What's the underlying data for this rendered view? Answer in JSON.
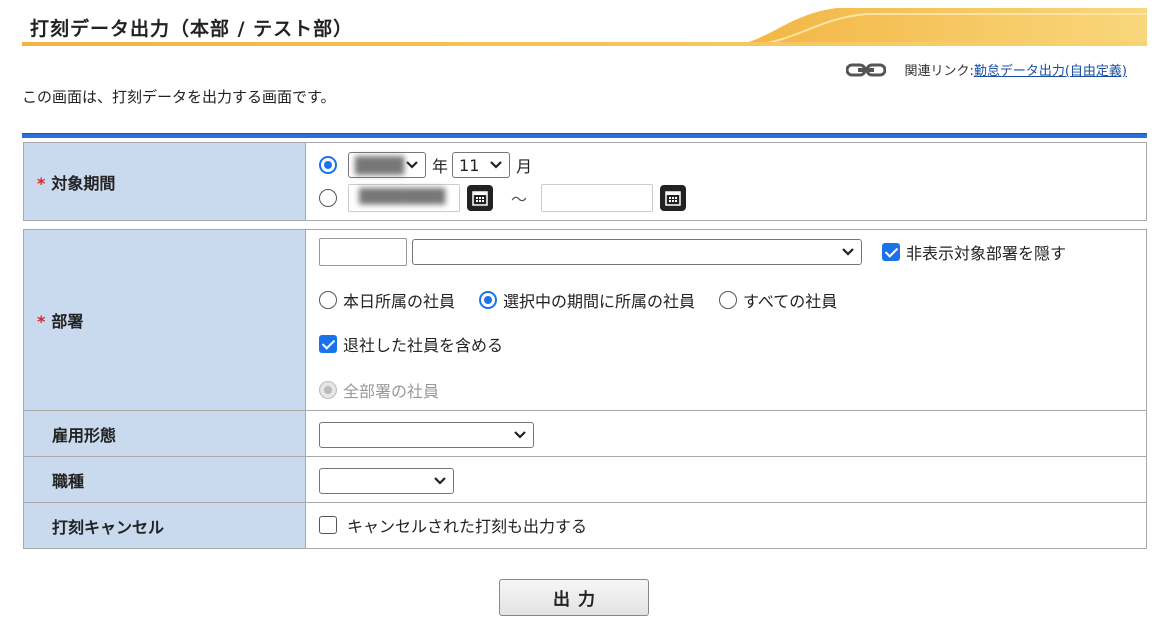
{
  "header": {
    "title": "打刻データ出力（本部 / テスト部）"
  },
  "related": {
    "prefix": "関連リンク: ",
    "link_label": "勤怠データ出力(自由定義)"
  },
  "description": "この画面は、打刻データを出力する画面です。",
  "colors": {
    "accent": "#2c6fd6",
    "label_bg": "#c9d9ee",
    "header_gold": "#f2b441",
    "required": "#e0202a"
  },
  "period": {
    "label": "対象期間",
    "required_mark": "*",
    "year_suffix": "年",
    "month_value": "11",
    "month_suffix": "月",
    "range_separator": "～"
  },
  "department": {
    "label": "部署",
    "required_mark": "*",
    "hide_hidden_label": "非表示対象部署を隠す",
    "radio_options": [
      "本日所属の社員",
      "選択中の期間に所属の社員",
      "すべての社員"
    ],
    "include_retired_label": "退社した社員を含める",
    "all_departments_label": "全部署の社員"
  },
  "employment": {
    "label": "雇用形態"
  },
  "job": {
    "label": "職種"
  },
  "cancel": {
    "label": "打刻キャンセル",
    "checkbox_label": "キャンセルされた打刻も出力する"
  },
  "submit": {
    "label": "出力"
  }
}
